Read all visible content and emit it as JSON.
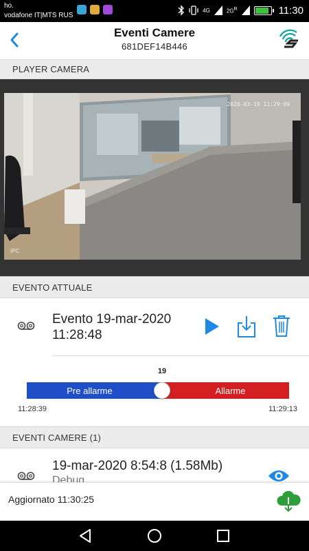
{
  "status_bar": {
    "carrier_line1": "ho.",
    "carrier_line2": "vodafone IT|MTS RUS",
    "network1": "4G",
    "network2": "2G",
    "roaming": "R",
    "battery_level": 0.9,
    "time": "11:30"
  },
  "header": {
    "title": "Eventi Camere",
    "subtitle": "681DEF14B446"
  },
  "sections": {
    "player": "PLAYER CAMERA",
    "current_event": "EVENTO ATTUALE",
    "camera_events": "EVENTI CAMERE (1)"
  },
  "camera": {
    "timestamp": "2020-03-19 11:29:09",
    "overlay_label": "IPC"
  },
  "current_event": {
    "title": "Evento 19-mar-2020 11:28:48"
  },
  "timeline": {
    "count": "19",
    "pre_alarm_label": "Pre allarme",
    "alarm_label": "Allarme",
    "start_time": "11:28:39",
    "end_time": "11:29:13",
    "position": 0.515
  },
  "events_list": [
    {
      "title": "19-mar-2020 8:54:8 (1.58Mb)",
      "subtitle": "Debug"
    }
  ],
  "footer": {
    "updated": "Aggiornato 11:30:25"
  },
  "colors": {
    "accent_blue": "#1e88e5",
    "pre_alarm": "#1e4fc8",
    "alarm": "#d41f22",
    "cloud_green": "#2e9e3a"
  }
}
